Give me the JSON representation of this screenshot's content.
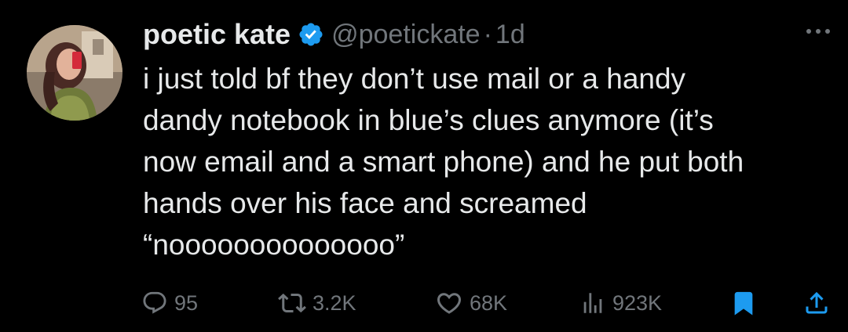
{
  "tweet": {
    "author_name": "poetic kate",
    "handle": "@poetickate",
    "separator": "·",
    "time": "1d",
    "text_lines": [
      "i just told bf they don’t use mail or a handy",
      "dandy notebook in blue’s clues anymore (it’s",
      "now email and a smart phone) and he put both",
      "hands over his face and screamed",
      "“noooooooooooooo”"
    ],
    "more_icon": "ellipsis-icon",
    "verified_icon": "verified-badge-icon",
    "verified_color": "#1d9bf0"
  },
  "actions": {
    "replies": {
      "icon": "reply-icon",
      "count": "95"
    },
    "reposts": {
      "icon": "repost-icon",
      "count": "3.2K"
    },
    "likes": {
      "icon": "heart-icon",
      "count": "68K"
    },
    "views": {
      "icon": "views-chart-icon",
      "count": "923K"
    },
    "bookmark": {
      "icon": "bookmark-icon",
      "color": "#1d9bf0"
    },
    "share": {
      "icon": "share-icon"
    }
  },
  "colors": {
    "background": "#000000",
    "primary_text": "#e7e9ea",
    "secondary_text": "#71767b",
    "accent": "#1d9bf0"
  }
}
